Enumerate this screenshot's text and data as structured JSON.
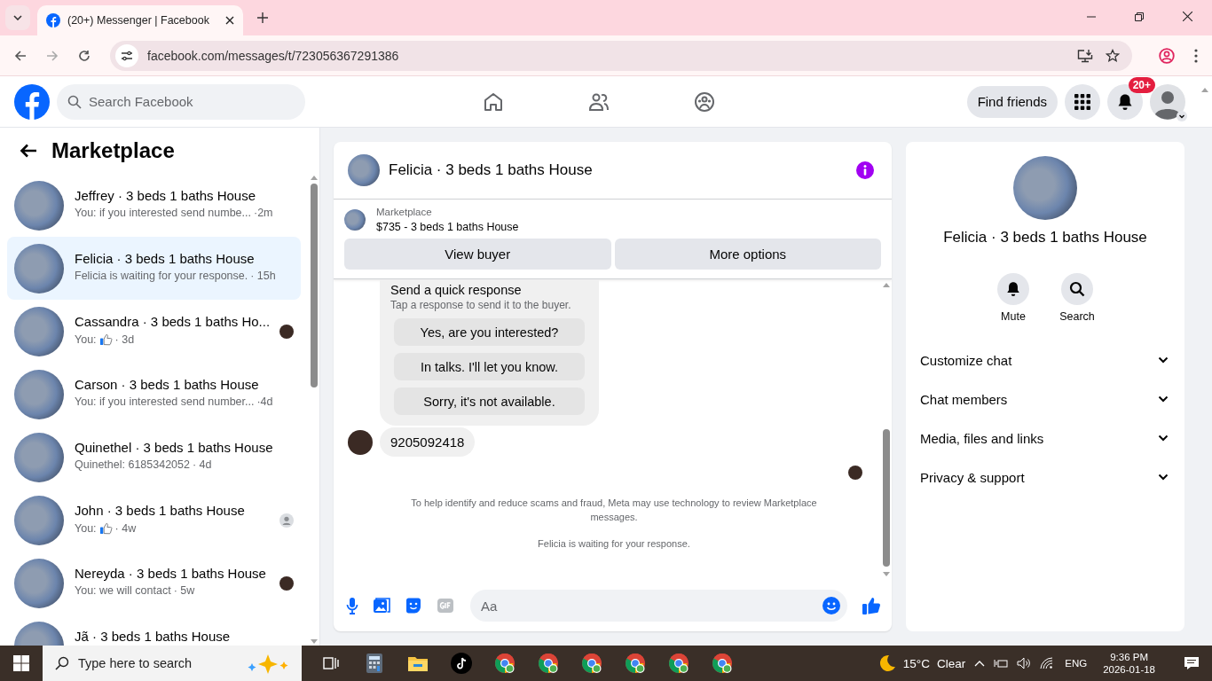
{
  "browser": {
    "tab_title": "(20+) Messenger | Facebook",
    "url": "facebook.com/messages/t/723056367291386"
  },
  "header": {
    "search_placeholder": "Search Facebook",
    "find_friends": "Find friends",
    "notification_badge": "20+"
  },
  "sidebar": {
    "title": "Marketplace",
    "conversations": [
      {
        "name": "Jeffrey · 3 beds 1 baths House",
        "preview": "You: if you interested send numbe...",
        "like": false,
        "time": "·2m",
        "selected": false
      },
      {
        "name": "Felicia · 3 beds 1 baths House",
        "preview": "Felicia is waiting for your response.",
        "like": false,
        "time": "· 15h",
        "selected": true
      },
      {
        "name": "Cassandra · 3 beds 1 baths Ho...",
        "preview": "You:",
        "like": true,
        "time": "· 3d",
        "selected": false,
        "read_receipt": {
          "kind": "photo"
        }
      },
      {
        "name": "Carson · 3 beds 1 baths House",
        "preview": "You: if you interested send number...",
        "like": false,
        "time": "·4d",
        "selected": false
      },
      {
        "name": "Quinethel · 3 beds 1 baths House",
        "preview": "Quinethel: 6185342052",
        "like": false,
        "time": "· 4d",
        "selected": false
      },
      {
        "name": "John · 3 beds 1 baths House",
        "preview": "You:",
        "like": true,
        "time": "· 4w",
        "selected": false,
        "read_receipt": {
          "kind": "silhouette"
        }
      },
      {
        "name": "Nereyda · 3 beds 1 baths House",
        "preview": "You: we will contact",
        "like": false,
        "time": "· 5w",
        "selected": false,
        "read_receipt": {
          "kind": "photo"
        }
      },
      {
        "name": "Jã · 3 beds 1 baths House",
        "like": false,
        "selected": false
      }
    ]
  },
  "chat": {
    "title": "Felicia · 3 beds 1 baths House",
    "listing": {
      "label": "Marketplace",
      "details": "$735 - 3 beds 1 baths House"
    },
    "actions": [
      "View buyer",
      "More options"
    ],
    "quick_response": {
      "title": "Send a quick response",
      "subtitle": "Tap a response to send it to the buyer.",
      "options": [
        "Yes, are you interested?",
        "In talks. I'll let you know.",
        "Sorry, it's not available."
      ]
    },
    "messages": [
      {
        "text": "9205092418"
      }
    ],
    "notice": "To help identify and reduce scams and fraud, Meta may use technology to review Marketplace messages.",
    "status": "Felicia is waiting for your response.",
    "composer_placeholder": "Aa"
  },
  "details": {
    "title": "Felicia · 3 beds 1 baths House",
    "actions": [
      {
        "kind": "mute",
        "label": "Mute"
      },
      {
        "kind": "search",
        "label": "Search"
      }
    ],
    "sections": [
      {
        "label": "Customize chat",
        "expanded": false
      },
      {
        "label": "Chat members",
        "expanded": false
      },
      {
        "label": "Media, files and links",
        "expanded": false
      },
      {
        "label": "Privacy & support",
        "expanded": false
      }
    ]
  },
  "taskbar": {
    "search_placeholder": "Type here to search",
    "temperature": "15°C",
    "weather": "Clear",
    "language": "ENG",
    "time": "9:36 PM",
    "date": "2026-01-18"
  }
}
